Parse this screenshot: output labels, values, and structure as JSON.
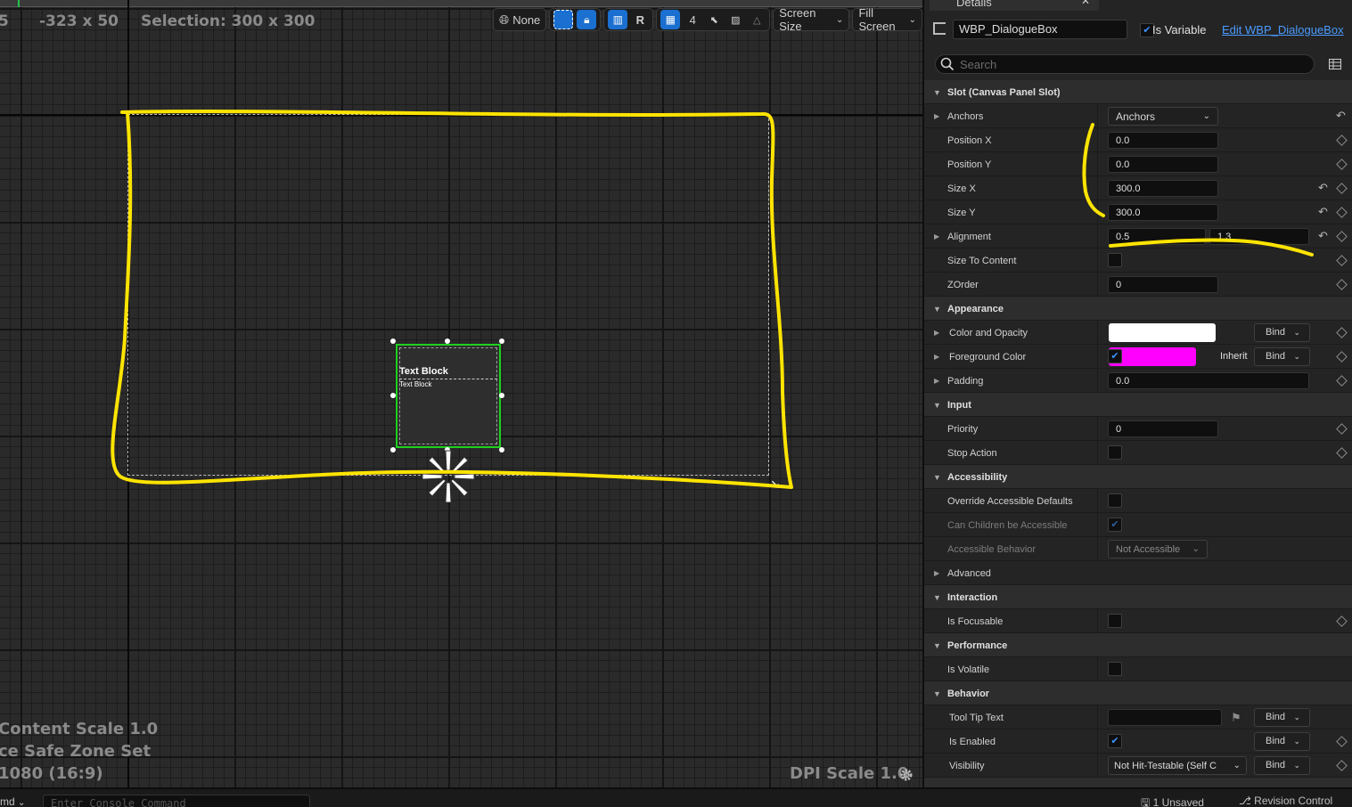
{
  "viewport": {
    "ruler_left_fragment": "5",
    "size_readout": "-323 x 50",
    "selection_readout": "Selection: 300 x 300",
    "content_scale": "Content Scale 1.0",
    "safe_zone": "ce Safe Zone Set",
    "resolution": "1080 (16:9)",
    "dpi_scale": "DPI Scale 1.0",
    "toolbar": {
      "locale_label": "None",
      "respect_locks_label": "R",
      "grid_size": "4",
      "screen_size_label": "Screen Size",
      "fill_mode_label": "Fill Screen"
    },
    "widget": {
      "title": "Text Block",
      "subtitle": "Text Block"
    }
  },
  "console": {
    "cmd_label": "md",
    "placeholder": "Enter Console Command"
  },
  "status": {
    "unsaved": "1 Unsaved",
    "revision": "Revision Control"
  },
  "details": {
    "tab_title": "Details",
    "widget_name": "WBP_DialogueBox",
    "is_variable_label": "Is Variable",
    "edit_link": "Edit WBP_DialogueBox",
    "search_placeholder": "Search",
    "bind_label": "Bind",
    "slot": {
      "title": "Slot (Canvas Panel Slot)",
      "anchors_label": "Anchors",
      "anchors_value": "Anchors",
      "position_x_label": "Position X",
      "position_x": "0.0",
      "position_y_label": "Position Y",
      "position_y": "0.0",
      "size_x_label": "Size X",
      "size_x": "300.0",
      "size_y_label": "Size Y",
      "size_y": "300.0",
      "alignment_label": "Alignment",
      "alignment_x": "0.5",
      "alignment_y": "1.3",
      "size_to_content_label": "Size To Content",
      "zorder_label": "ZOrder",
      "zorder": "0"
    },
    "appearance": {
      "title": "Appearance",
      "color_opacity_label": "Color and Opacity",
      "color_opacity": "#ffffff",
      "foreground_label": "Foreground Color",
      "foreground": "#ff00ff",
      "inherit_label": "Inherit",
      "padding_label": "Padding",
      "padding": "0.0"
    },
    "input": {
      "title": "Input",
      "priority_label": "Priority",
      "priority": "0",
      "stop_action_label": "Stop Action"
    },
    "accessibility": {
      "title": "Accessibility",
      "override_label": "Override Accessible Defaults",
      "children_label": "Can Children be Accessible",
      "behavior_label": "Accessible Behavior",
      "behavior_value": "Not Accessible"
    },
    "advanced": {
      "title": "Advanced"
    },
    "interaction": {
      "title": "Interaction",
      "focusable_label": "Is Focusable"
    },
    "performance": {
      "title": "Performance",
      "volatile_label": "Is Volatile"
    },
    "behavior": {
      "title": "Behavior",
      "tooltip_label": "Tool Tip Text",
      "enabled_label": "Is Enabled",
      "visibility_label": "Visibility",
      "visibility_value": "Not Hit-Testable (Self C"
    }
  },
  "colors": {
    "annotation": "#ffe400",
    "selection": "#1ed01e",
    "accent": "#1a6fd0"
  }
}
